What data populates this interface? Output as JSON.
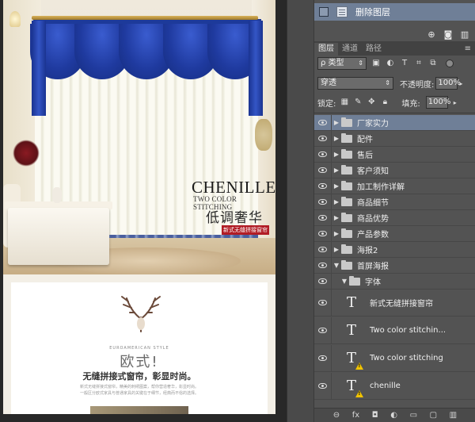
{
  "document": {
    "brand_title": "CHENILLE",
    "brand_subtitle": "TWO COLOR STITCHING",
    "brand_cn": "低调奢华",
    "brand_tag": "新式无缝拼接窗帘",
    "lower_en": "EUROAMERICAN STYLE",
    "lower_title": "欧式!",
    "lower_subtitle": "无缝拼接式窗帘，彰显时尚。",
    "lower_line1": "新式无缝拼接式窗帘，精美的刺绣图案，帮你营造奢华，彰显时尚。",
    "lower_line2": "一般区分欧式家具与普通家具的关键在于细节，经典而不俗的选择。"
  },
  "history": {
    "item_label": "删除图层",
    "icons": [
      "new-snapshot-icon",
      "camera-icon",
      "trash-icon"
    ]
  },
  "layers_panel": {
    "tabs": [
      "图层",
      "通道",
      "路径"
    ],
    "filter_label": "ρ 类型",
    "blend_mode": "穿透",
    "opacity_label": "不透明度:",
    "opacity_value": "100%",
    "lock_label": "锁定:",
    "fill_label": "填充:",
    "fill_value": "100%",
    "groups": [
      {
        "name": "厂家实力",
        "selected": true
      },
      {
        "name": "配件"
      },
      {
        "name": "售后"
      },
      {
        "name": "客户须知"
      },
      {
        "name": "加工制作详解"
      },
      {
        "name": "商品细节"
      },
      {
        "name": "商品优势"
      },
      {
        "name": "产品参数"
      },
      {
        "name": "海报2"
      },
      {
        "name": "首屏海报",
        "expanded": true
      },
      {
        "name": "字体",
        "expanded": true
      }
    ],
    "text_layers": [
      {
        "name": "新式无缝拼接窗帘",
        "warning": false
      },
      {
        "name": "Two color stitchin...",
        "warning": false
      },
      {
        "name": "Two color stitching",
        "warning": true
      },
      {
        "name": "chenille",
        "warning": true
      }
    ],
    "bottom_icons": [
      "link-icon",
      "fx-icon",
      "mask-icon",
      "adjustment-icon",
      "group-icon",
      "new-layer-icon",
      "trash-icon"
    ]
  },
  "colors": {
    "selection": "#6f7f97",
    "panel_bg": "#535353",
    "curtain_blue": "#1f3a9f",
    "tag_red": "#b11c25"
  }
}
